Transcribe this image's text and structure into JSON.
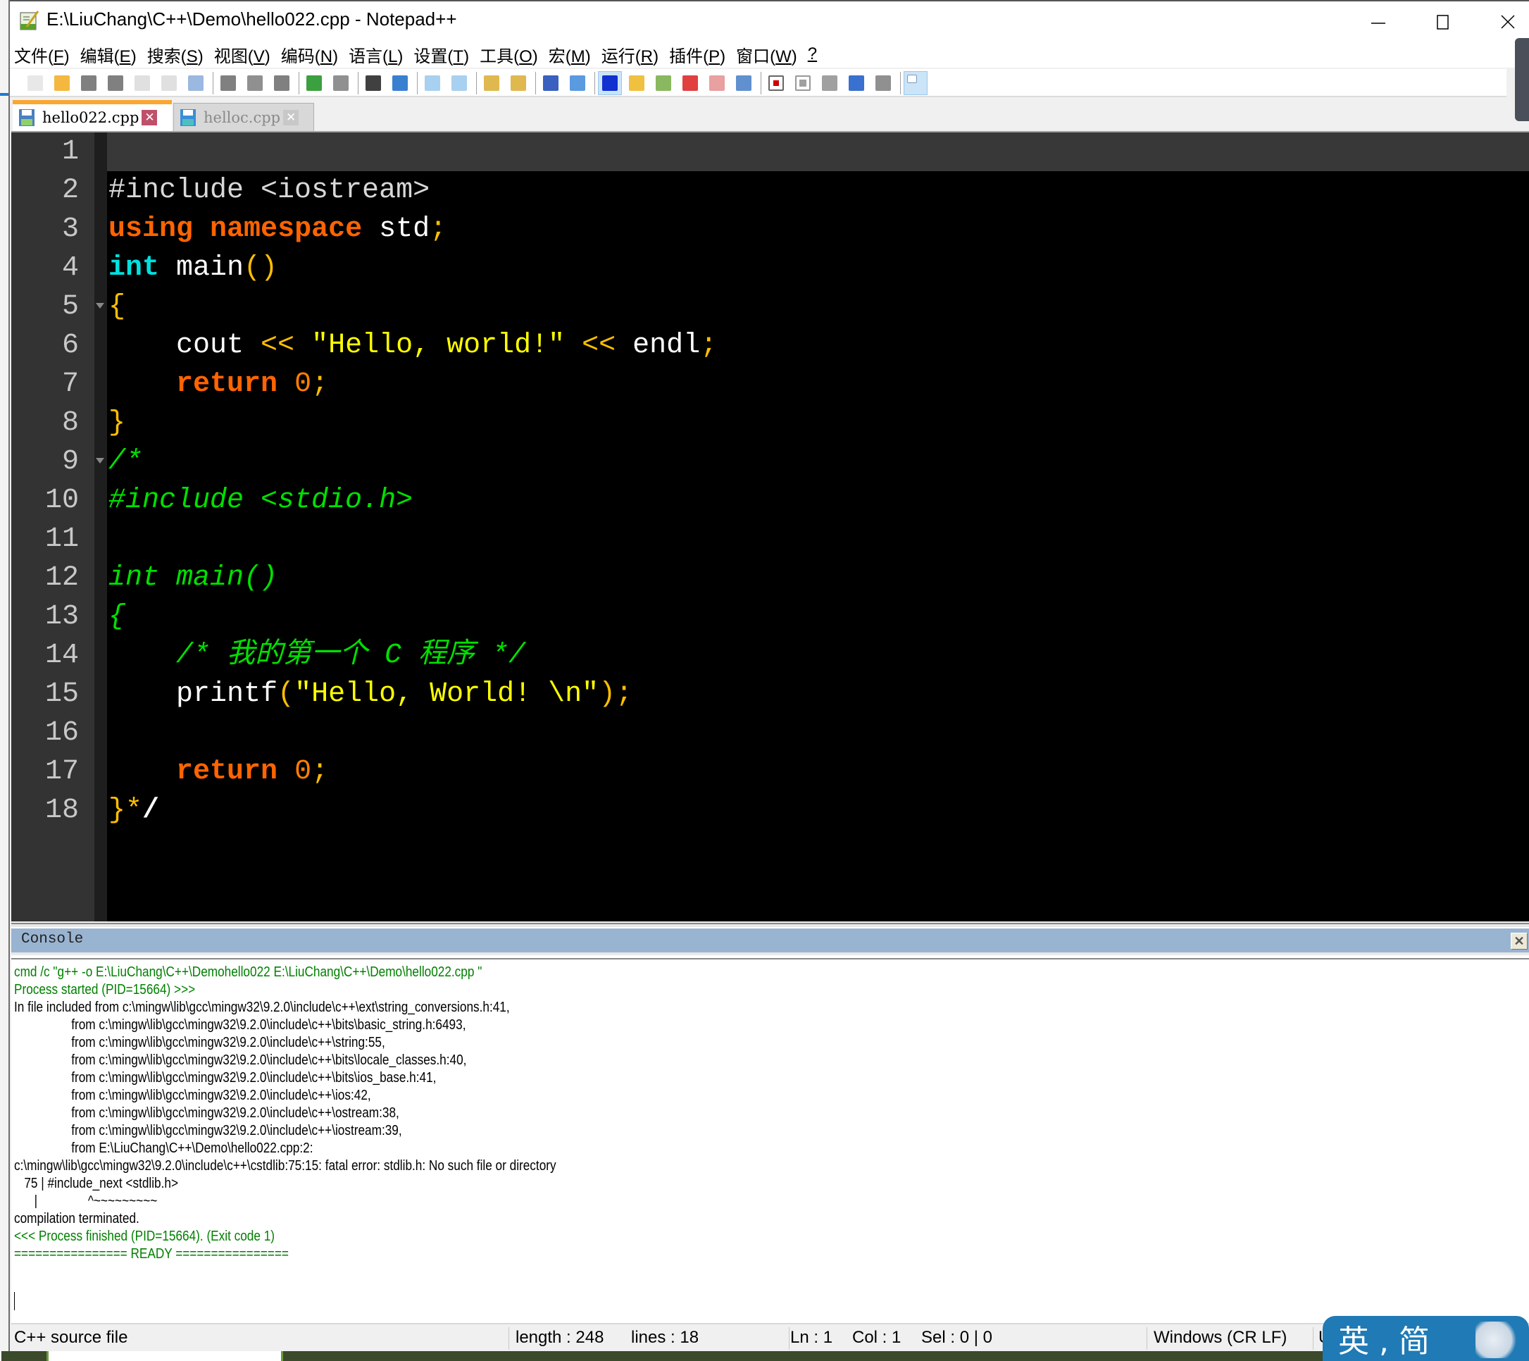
{
  "window": {
    "title": "E:\\LiuChang\\C++\\Demo\\hello022.cpp - Notepad++",
    "controls": {
      "minimize": "—",
      "maximize": "☐",
      "close": "✕"
    }
  },
  "menu": [
    {
      "label": "文件(",
      "key": "F",
      "tail": ")"
    },
    {
      "label": "编辑(",
      "key": "E",
      "tail": ")"
    },
    {
      "label": "搜索(",
      "key": "S",
      "tail": ")"
    },
    {
      "label": "视图(",
      "key": "V",
      "tail": ")"
    },
    {
      "label": "编码(",
      "key": "N",
      "tail": ")"
    },
    {
      "label": "语言(",
      "key": "L",
      "tail": ")"
    },
    {
      "label": "设置(",
      "key": "T",
      "tail": ")"
    },
    {
      "label": "工具(",
      "key": "O",
      "tail": ")"
    },
    {
      "label": "宏(",
      "key": "M",
      "tail": ")"
    },
    {
      "label": "运行(",
      "key": "R",
      "tail": ")"
    },
    {
      "label": "插件(",
      "key": "P",
      "tail": ")"
    },
    {
      "label": "窗口(",
      "key": "W",
      "tail": ")"
    },
    {
      "label": "",
      "key": "?",
      "tail": ""
    }
  ],
  "toolbar": [
    "new-file-icon",
    "open-file-icon",
    "save-icon",
    "save-all-icon",
    "close-icon",
    "close-all-icon",
    "print-icon",
    "cut-icon",
    "copy-icon",
    "paste-icon",
    "undo-icon",
    "redo-icon",
    "find-icon",
    "replace-icon",
    "zoom-in-icon",
    "zoom-out-icon",
    "sync-vertical-icon",
    "sync-horizontal-icon",
    "word-wrap-icon",
    "show-all-chars-icon",
    "indent-guide-icon",
    "user-language-icon",
    "document-map-icon",
    "function-list-icon",
    "folder-workspace-icon",
    "monitoring-icon",
    "record-macro-icon",
    "stop-macro-icon",
    "play-macro-icon",
    "run-macro-multiple-icon",
    "save-macro-icon",
    "console-icon"
  ],
  "tabs": [
    {
      "label": "hello022.cpp",
      "active": true
    },
    {
      "label": "helloc.cpp",
      "active": false
    }
  ],
  "editor": {
    "lines": [
      {
        "n": "1",
        "fold": false,
        "tokens": []
      },
      {
        "n": "2",
        "fold": false,
        "tokens": [
          [
            "pre",
            "#include <iostream>"
          ]
        ]
      },
      {
        "n": "3",
        "fold": false,
        "tokens": [
          [
            "kw",
            "using"
          ],
          [
            "",
            " "
          ],
          [
            "kw",
            "namespace"
          ],
          [
            "",
            " std"
          ],
          [
            "op",
            ";"
          ]
        ]
      },
      {
        "n": "4",
        "fold": false,
        "tokens": [
          [
            "type",
            "int"
          ],
          [
            "",
            " main"
          ],
          [
            "op",
            "()"
          ]
        ]
      },
      {
        "n": "5",
        "fold": true,
        "tokens": [
          [
            "op",
            "{"
          ]
        ]
      },
      {
        "n": "6",
        "fold": false,
        "tokens": [
          [
            "",
            "    cout "
          ],
          [
            "op",
            "<<"
          ],
          [
            "",
            " "
          ],
          [
            "str",
            "\"Hello, world!\""
          ],
          [
            "",
            " "
          ],
          [
            "op",
            "<<"
          ],
          [
            "",
            " endl"
          ],
          [
            "op",
            ";"
          ]
        ]
      },
      {
        "n": "7",
        "fold": false,
        "tokens": [
          [
            "",
            "    "
          ],
          [
            "kw",
            "return"
          ],
          [
            "",
            " "
          ],
          [
            "num",
            "0"
          ],
          [
            "op",
            ";"
          ]
        ]
      },
      {
        "n": "8",
        "fold": false,
        "tokens": [
          [
            "op",
            "}"
          ]
        ]
      },
      {
        "n": "9",
        "fold": true,
        "tokens": [
          [
            "cm",
            "/*"
          ]
        ]
      },
      {
        "n": "10",
        "fold": false,
        "tokens": [
          [
            "cm",
            "#include <stdio.h>"
          ]
        ]
      },
      {
        "n": "11",
        "fold": false,
        "tokens": []
      },
      {
        "n": "12",
        "fold": false,
        "tokens": [
          [
            "cm",
            "int main()"
          ]
        ]
      },
      {
        "n": "13",
        "fold": false,
        "tokens": [
          [
            "cm",
            "{"
          ]
        ]
      },
      {
        "n": "14",
        "fold": false,
        "tokens": [
          [
            "cm",
            "    /* 我的第一个 C 程序 */"
          ]
        ]
      },
      {
        "n": "15",
        "fold": false,
        "tokens": [
          [
            "",
            "    printf"
          ],
          [
            "op",
            "("
          ],
          [
            "str",
            "\"Hello, World! \\n\""
          ],
          [
            "op",
            ");"
          ]
        ]
      },
      {
        "n": "16",
        "fold": false,
        "tokens": []
      },
      {
        "n": "17",
        "fold": false,
        "tokens": [
          [
            "",
            "    "
          ],
          [
            "kw",
            "return"
          ],
          [
            "",
            " "
          ],
          [
            "num",
            "0"
          ],
          [
            "op",
            ";"
          ]
        ]
      },
      {
        "n": "18",
        "fold": false,
        "tokens": [
          [
            "op",
            "}*"
          ],
          [
            "white",
            "/"
          ]
        ]
      }
    ]
  },
  "console": {
    "title": "Console",
    "close": "✕",
    "lines": [
      {
        "text": "cmd /c \"g++ -o E:\\LiuChang\\C++\\Demohello022 E:\\LiuChang\\C++\\Demo\\hello022.cpp \"",
        "color": "green"
      },
      {
        "text": "Process started (PID=15664) >>>",
        "color": "green"
      },
      {
        "text": "In file included from c:\\mingw\\lib\\gcc\\mingw32\\9.2.0\\include\\c++\\ext\\string_conversions.h:41,",
        "color": "black"
      },
      {
        "text": "                 from c:\\mingw\\lib\\gcc\\mingw32\\9.2.0\\include\\c++\\bits\\basic_string.h:6493,",
        "color": "black"
      },
      {
        "text": "                 from c:\\mingw\\lib\\gcc\\mingw32\\9.2.0\\include\\c++\\string:55,",
        "color": "black"
      },
      {
        "text": "                 from c:\\mingw\\lib\\gcc\\mingw32\\9.2.0\\include\\c++\\bits\\locale_classes.h:40,",
        "color": "black"
      },
      {
        "text": "                 from c:\\mingw\\lib\\gcc\\mingw32\\9.2.0\\include\\c++\\bits\\ios_base.h:41,",
        "color": "black"
      },
      {
        "text": "                 from c:\\mingw\\lib\\gcc\\mingw32\\9.2.0\\include\\c++\\ios:42,",
        "color": "black"
      },
      {
        "text": "                 from c:\\mingw\\lib\\gcc\\mingw32\\9.2.0\\include\\c++\\ostream:38,",
        "color": "black"
      },
      {
        "text": "                 from c:\\mingw\\lib\\gcc\\mingw32\\9.2.0\\include\\c++\\iostream:39,",
        "color": "black"
      },
      {
        "text": "                 from E:\\LiuChang\\C++\\Demo\\hello022.cpp:2:",
        "color": "black"
      },
      {
        "text": "c:\\mingw\\lib\\gcc\\mingw32\\9.2.0\\include\\c++\\cstdlib:75:15: fatal error: stdlib.h: No such file or directory",
        "color": "black"
      },
      {
        "text": "   75 | #include_next <stdlib.h>",
        "color": "black"
      },
      {
        "text": "      |               ^~~~~~~~~~",
        "color": "black"
      },
      {
        "text": "compilation terminated.",
        "color": "black"
      },
      {
        "text": "<<< Process finished (PID=15664). (Exit code 1)",
        "color": "green"
      },
      {
        "text": "================ READY ================",
        "color": "green"
      }
    ]
  },
  "status": {
    "file_type": "C++ source file",
    "length": "length : 248",
    "lines": "lines : 18",
    "ln": "Ln : 1",
    "col": "Col : 1",
    "sel": "Sel : 0 | 0",
    "eol": "Windows (CR LF)",
    "encoding_partial": "U"
  },
  "ime": {
    "label": "英 , 简"
  },
  "colors": {
    "accent_tab": "#faa732",
    "keyword": "#ff6400",
    "type": "#00e0e0",
    "string": "#ffff00",
    "operator": "#ffbf00",
    "comment": "#00e000",
    "console_header": "#99b4d1",
    "console_green": "#008000"
  }
}
